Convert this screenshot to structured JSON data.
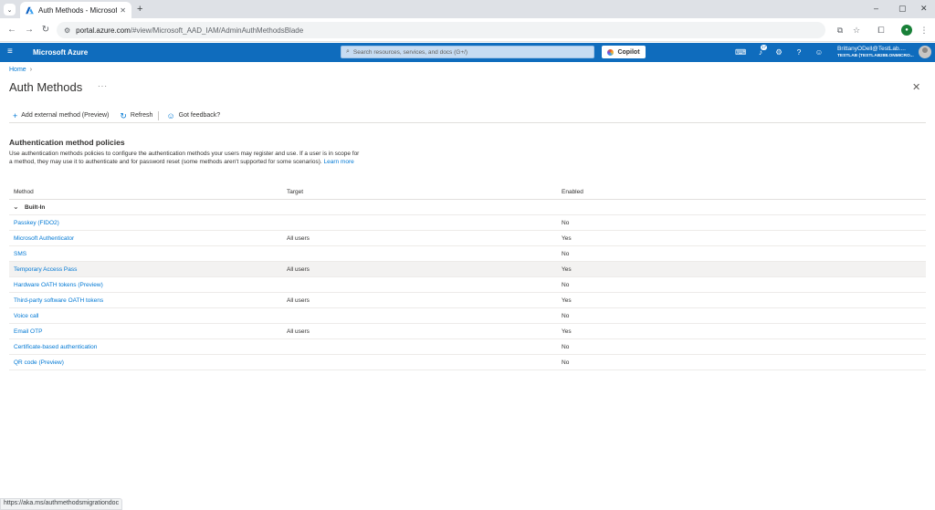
{
  "browser": {
    "tab_title": "Auth Methods - Microsoft",
    "url_host": "portal.azure.com",
    "url_path": "/#view/Microsoft_AAD_IAM/AdminAuthMethodsBlade",
    "status_url": "https://aka.ms/authmethodsmigrationdoc"
  },
  "azure_header": {
    "brand": "Microsoft Azure",
    "search_placeholder": "Search resources, services, and docs (G+/)",
    "copilot_label": "Copilot",
    "notification_count": "17",
    "account_name": "BrittanyODell@TestLab....",
    "account_tenant": "TESTLAB (TESTLAB288.ONMICRO..."
  },
  "breadcrumb": {
    "home": "Home"
  },
  "page": {
    "title": "Auth Methods",
    "more": "···"
  },
  "commands": {
    "add_external": "Add external method (Preview)",
    "refresh": "Refresh",
    "feedback": "Got feedback?"
  },
  "section": {
    "title": "Authentication method policies",
    "description": "Use authentication methods policies to configure the authentication methods your users may register and use. If a user is in scope for a method, they may use it to authenticate and for password reset (some methods aren't supported for some scenarios).",
    "learn_more": "Learn more"
  },
  "table": {
    "headers": {
      "method": "Method",
      "target": "Target",
      "enabled": "Enabled"
    },
    "group": "Built-In",
    "rows": [
      {
        "method": "Passkey (FIDO2)",
        "target": "",
        "enabled": "No"
      },
      {
        "method": "Microsoft Authenticator",
        "target": "All users",
        "enabled": "Yes"
      },
      {
        "method": "SMS",
        "target": "",
        "enabled": "No"
      },
      {
        "method": "Temporary Access Pass",
        "target": "All users",
        "enabled": "Yes"
      },
      {
        "method": "Hardware OATH tokens (Preview)",
        "target": "",
        "enabled": "No"
      },
      {
        "method": "Third-party software OATH tokens",
        "target": "All users",
        "enabled": "Yes"
      },
      {
        "method": "Voice call",
        "target": "",
        "enabled": "No"
      },
      {
        "method": "Email OTP",
        "target": "All users",
        "enabled": "Yes"
      },
      {
        "method": "Certificate-based authentication",
        "target": "",
        "enabled": "No"
      },
      {
        "method": "QR code (Preview)",
        "target": "",
        "enabled": "No"
      }
    ]
  },
  "colors": {
    "azure_blue": "#0f6cbd",
    "link": "#0078d4",
    "row_highlight": "#f3f2f1"
  }
}
